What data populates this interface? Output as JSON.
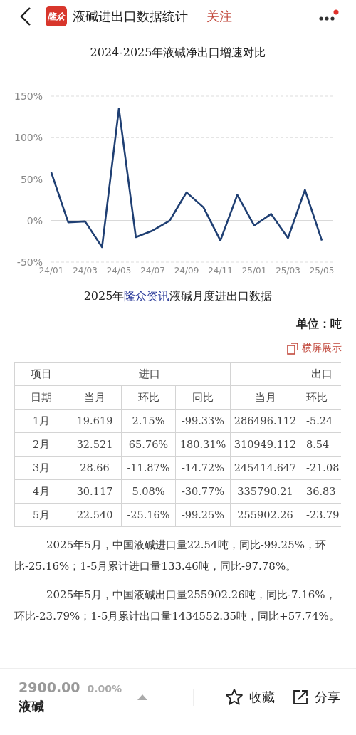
{
  "header": {
    "logo": "隆众",
    "title": "液碱进出口数据统计",
    "follow": "关注",
    "has_badge": true
  },
  "chart_data": {
    "type": "line",
    "title": "2024-2025年液碱净出口增速对比",
    "categories": [
      "24/01",
      null,
      "24/03",
      null,
      "24/05",
      null,
      "24/07",
      null,
      "24/09",
      null,
      "24/11",
      null,
      "25/01",
      null,
      "25/03",
      null,
      "25/05"
    ],
    "series": [
      {
        "color": "#1f3f73",
        "values": [
          58,
          -2,
          -1,
          -32,
          135,
          -20,
          -12,
          0,
          34,
          16,
          -24,
          31,
          -6,
          8,
          -21,
          37,
          -24
        ]
      }
    ],
    "ylim": [
      -50,
      150
    ],
    "yticks": [
      {
        "value": 150,
        "label": "150%"
      },
      {
        "value": 100,
        "label": "100%"
      },
      {
        "value": 50,
        "label": "50%"
      },
      {
        "value": 0,
        "label": "0%"
      },
      {
        "value": -50,
        "label": "-50%"
      }
    ]
  },
  "table_title": {
    "before": "2025年",
    "brand": "隆众资讯",
    "after": "液碱月度进出口数据"
  },
  "unit": "单位：吨",
  "landscape": "横屏展示",
  "table": {
    "group_header": [
      "项目",
      "进口",
      "出口"
    ],
    "columns": [
      "日期",
      "当月",
      "环比",
      "同比",
      "当月",
      "环比"
    ],
    "rows": [
      [
        "1月",
        "19.619",
        "2.15%",
        "-99.33%",
        "286496.112",
        "-5.24"
      ],
      [
        "2月",
        "32.521",
        "65.76%",
        "180.31%",
        "310949.112",
        "8.54"
      ],
      [
        "3月",
        "28.66",
        "-11.87%",
        "-14.72%",
        "245414.647",
        "-21.08"
      ],
      [
        "4月",
        "30.117",
        "5.08%",
        "-30.77%",
        "335790.21",
        "36.83"
      ],
      [
        "5月",
        "22.540",
        "-25.16%",
        "-99.25%",
        "255902.26",
        "-23.79"
      ]
    ]
  },
  "paragraphs": [
    "2025年5月，中国液碱进口量22.54吨，同比-99.25%，环比-25.16%；1-5月累计进口量133.46吨，同比-97.78%。",
    "2025年5月，中国液碱出口量255902.26吨，同比-7.16%，环比-23.79%；1-5月累计出口量1434552.35吨，同比+57.74%。"
  ],
  "bottom_bar": {
    "price": "2900.00",
    "change": "0.00%",
    "name": "液碱",
    "favorite": "收藏",
    "share": "分享"
  }
}
